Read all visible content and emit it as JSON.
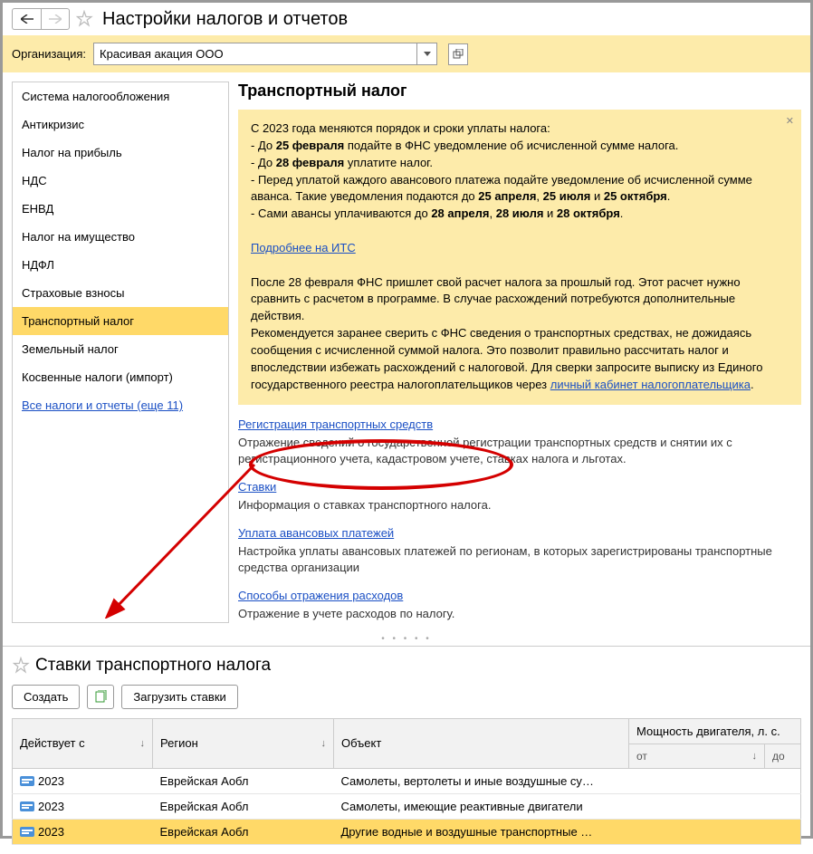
{
  "header": {
    "title": "Настройки налогов и отчетов"
  },
  "org": {
    "label": "Организация:",
    "value": "Красивая акация ООО"
  },
  "sidebar": {
    "items": [
      {
        "label": "Система налогообложения"
      },
      {
        "label": "Антикризис"
      },
      {
        "label": "Налог на прибыль"
      },
      {
        "label": "НДС"
      },
      {
        "label": "ЕНВД"
      },
      {
        "label": "Налог на имущество"
      },
      {
        "label": "НДФЛ"
      },
      {
        "label": "Страховые взносы"
      },
      {
        "label": "Транспортный налог"
      },
      {
        "label": "Земельный налог"
      },
      {
        "label": "Косвенные налоги (импорт)"
      }
    ],
    "more_link": "Все налоги и отчеты (еще 11)"
  },
  "content": {
    "title": "Транспортный налог",
    "info": {
      "line1": "С 2023 года меняются порядок и сроки уплаты налога:",
      "line2a": " - До ",
      "line2b": "25 февраля",
      "line2c": " подайте в ФНС уведомление об исчисленной сумме налога.",
      "line3a": " - До ",
      "line3b": "28 февраля",
      "line3c": " уплатите налог.",
      "line4a": " - Перед уплатой каждого авансового платежа подайте уведомление об исчисленной сумме аванса. Такие уведомления подаются до ",
      "line4b": "25 апреля",
      "line4c": ", ",
      "line4d": "25 июля",
      "line4e": " и ",
      "line4f": "25 октября",
      "line4g": ".",
      "line5a": " - Сами авансы уплачиваются до ",
      "line5b": "28 апреля",
      "line5c": ", ",
      "line5d": "28 июля",
      "line5e": " и ",
      "line5f": "28 октября",
      "line5g": ".",
      "link1": "Подробнее на ИТС",
      "para2": "После 28 февраля ФНС пришлет свой расчет налога за прошлый год. Этот расчет нужно сравнить с расчетом в программе. В случае расхождений потребуются дополнительные действия.",
      "para3a": "Рекомендуется заранее сверить с ФНС сведения о транспортных средствах, не дожидаясь сообщения с исчисленной суммой налога. Это позволит правильно рассчитать налог и впоследствии избежать расхождений с налоговой. Для сверки запросите выписку из Единого государственного реестра налогоплательщиков через ",
      "link2": "личный кабинет налогоплательщика",
      "para3b": "."
    },
    "sections": [
      {
        "link": "Регистрация транспортных средств",
        "desc": "Отражение сведений о государственной регистрации транспортных средств и снятии их с регистрационного учета, кадастровом учете, ставках налога и льготах."
      },
      {
        "link": "Ставки",
        "desc": "Информация о ставках транспортного налога."
      },
      {
        "link": "Уплата авансовых платежей",
        "desc": "Настройка уплаты авансовых платежей по регионам, в которых зарегистрированы транспортные средства организации"
      },
      {
        "link": "Способы отражения расходов",
        "desc": "Отражение в учете расходов по налогу."
      }
    ]
  },
  "second": {
    "title": "Ставки транспортного налога",
    "buttons": {
      "create": "Создать",
      "load": "Загрузить ставки"
    },
    "columns": {
      "c1": "Действует с",
      "c2": "Регион",
      "c3": "Объект",
      "c4": "Мощность двигателя, л. с.",
      "c4a": "от",
      "c4b": "до"
    },
    "rows": [
      {
        "year": "2023",
        "region": "Еврейская Аобл",
        "object": "Самолеты, вертолеты и иные воздушные су…"
      },
      {
        "year": "2023",
        "region": "Еврейская Аобл",
        "object": "Самолеты, имеющие реактивные двигатели"
      },
      {
        "year": "2023",
        "region": "Еврейская Аобл",
        "object": "Другие водные и воздушные транспортные …"
      }
    ]
  }
}
